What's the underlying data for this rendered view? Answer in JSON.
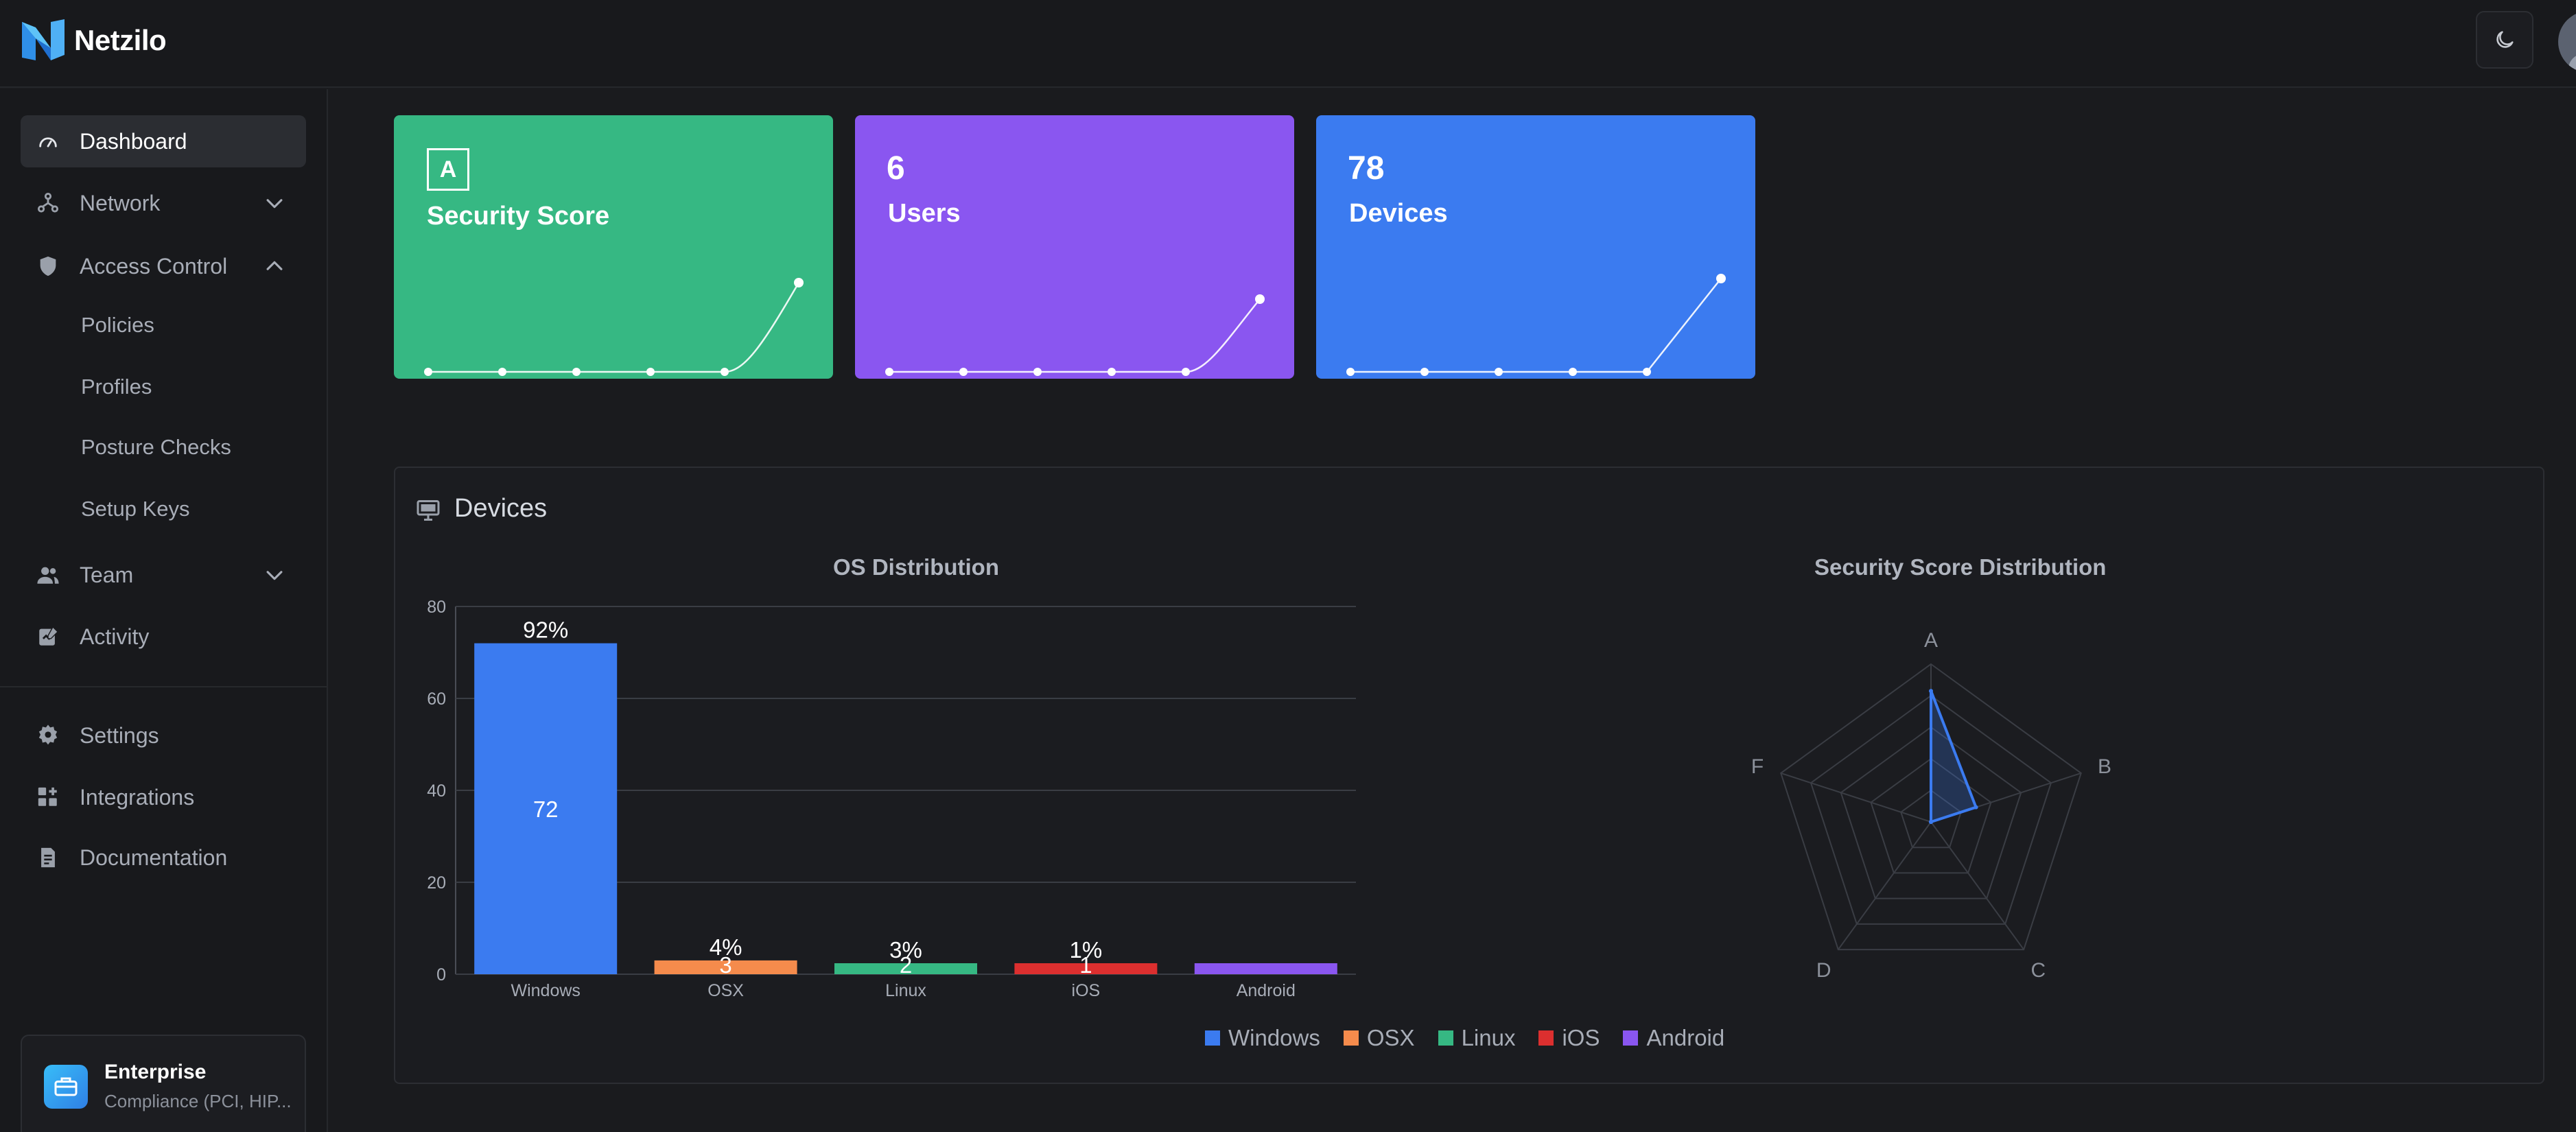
{
  "app": {
    "name": "Netzilo"
  },
  "sidebar": {
    "items": [
      {
        "label": "Dashboard",
        "icon": "gauge-icon",
        "active": true
      },
      {
        "label": "Network",
        "icon": "network-icon",
        "chevron": "down"
      },
      {
        "label": "Access Control",
        "icon": "shield-icon",
        "chevron": "up"
      },
      {
        "label": "Team",
        "icon": "team-icon",
        "chevron": "down"
      },
      {
        "label": "Activity",
        "icon": "activity-icon"
      },
      {
        "label": "Settings",
        "icon": "gear-icon"
      },
      {
        "label": "Integrations",
        "icon": "integrations-icon"
      },
      {
        "label": "Documentation",
        "icon": "document-icon"
      }
    ],
    "access_control_sub": [
      "Policies",
      "Profiles",
      "Posture Checks",
      "Setup Keys"
    ],
    "plan": {
      "title": "Enterprise",
      "subtitle": "Compliance (PCI, HIP..."
    }
  },
  "cards": {
    "security": {
      "grade": "A",
      "label": "Security Score",
      "color": "#36b883"
    },
    "users": {
      "value": "6",
      "label": "Users",
      "color": "#8a56f0"
    },
    "devices": {
      "value": "78",
      "label": "Devices",
      "color": "#3b7bf0"
    }
  },
  "devices_panel": {
    "title": "Devices"
  },
  "chart_data": [
    {
      "type": "bar",
      "title": "OS Distribution",
      "categories": [
        "Windows",
        "OSX",
        "Linux",
        "iOS",
        "Android"
      ],
      "values": [
        72,
        3,
        2,
        1,
        0
      ],
      "percent_labels": [
        "92%",
        "4%",
        "3%",
        "1%",
        ""
      ],
      "count_labels": [
        "72",
        "3",
        "2",
        "1",
        ""
      ],
      "colors": [
        "#3b7bf0",
        "#f58b4c",
        "#36b883",
        "#dc2f2f",
        "#8a56f0"
      ],
      "yticks": [
        0,
        20,
        40,
        60,
        80
      ],
      "ylim": [
        0,
        80
      ],
      "legend_position": "bottom",
      "grid": true
    },
    {
      "type": "radar",
      "title": "Security Score Distribution",
      "axes": [
        "A",
        "B",
        "C",
        "D",
        "F"
      ],
      "values": [
        0.83,
        0.3,
        0.0,
        0.0,
        0.0
      ],
      "color": "#3b7bf0"
    }
  ]
}
